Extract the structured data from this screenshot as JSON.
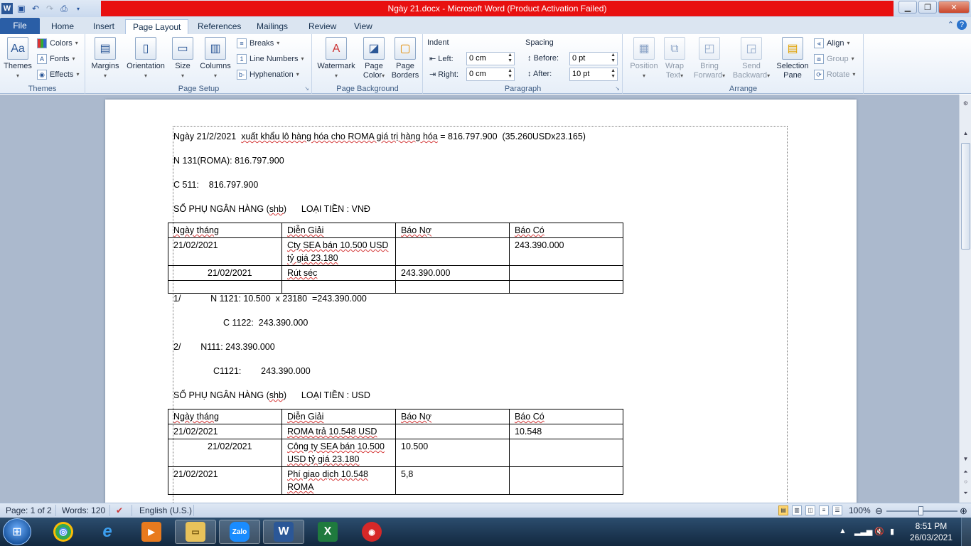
{
  "window": {
    "title": "Ngày 21.docx  -  Microsoft Word (Product Activation Failed)"
  },
  "ribbon_tabs": [
    "File",
    "Home",
    "Insert",
    "Page Layout",
    "References",
    "Mailings",
    "Review",
    "View"
  ],
  "active_tab": "Page Layout",
  "ribbon": {
    "themes": {
      "themes_btn": "Themes",
      "colors_btn": "Colors",
      "fonts_btn": "Fonts",
      "effects_btn": "Effects",
      "label": "Themes"
    },
    "page_setup": {
      "margins": "Margins",
      "orientation": "Orientation",
      "size": "Size",
      "columns": "Columns",
      "breaks": "Breaks",
      "line_numbers": "Line Numbers",
      "hyphenation": "Hyphenation",
      "label": "Page Setup"
    },
    "page_background": {
      "watermark": "Watermark",
      "page_color_1": "Page",
      "page_color_2": "Color",
      "page_borders_1": "Page",
      "page_borders_2": "Borders",
      "label": "Page Background"
    },
    "paragraph": {
      "indent_title": "Indent",
      "left_label": "Left:",
      "left_value": "0 cm",
      "right_label": "Right:",
      "right_value": "0 cm",
      "spacing_title": "Spacing",
      "before_label": "Before:",
      "before_value": "0 pt",
      "after_label": "After:",
      "after_value": "10 pt",
      "label": "Paragraph"
    },
    "arrange": {
      "position": "Position",
      "wrap_1": "Wrap",
      "wrap_2": "Text",
      "bring_1": "Bring",
      "bring_2": "Forward",
      "send_1": "Send",
      "send_2": "Backward",
      "selection_1": "Selection",
      "selection_2": "Pane",
      "align": "Align",
      "group": "Group",
      "rotate": "Rotate",
      "label": "Arrange"
    }
  },
  "document": {
    "l1_a": "Ngày 21/2/2021  ",
    "l1_b": "xuất khẩu lô hàng hóa cho ROMA giá trị hàng hóa",
    "l1_c": " = 816.797.900  (35.260USDx23.165)",
    "l2": "N 131(ROMA): 816.797.900",
    "l3": "C 511:    816.797.900",
    "l4_a": "SỔ PHỤ NGÂN HÀNG (",
    "l4_b": "shb",
    "l4_c": ")      LOẠI TIỀN : VNĐ",
    "table1": {
      "headers": [
        "Ngày tháng",
        "Diễn Giải",
        "Báo Nợ",
        "Báo Có"
      ],
      "rows": [
        [
          "21/02/2021",
          "Cty SEA bán 10.500  USD tỷ giá 23.180",
          "",
          "243.390.000"
        ],
        [
          "21/02/2021",
          "Rút séc",
          "243.390.000",
          ""
        ],
        [
          "",
          "",
          "",
          ""
        ]
      ]
    },
    "l5": "1/            N 1121: 10.500  x 23180  =243.390.000",
    "l6": "C 1122:  243.390.000",
    "l7": "2/        N111: 243.390.000",
    "l8": "C1121:        243.390.000",
    "l9_a": "SỔ PHỤ NGÂN HÀNG (",
    "l9_b": "shb",
    "l9_c": ")      LOẠI TIỀN : USD",
    "table2": {
      "headers": [
        "Ngày tháng",
        "Diễn Giải",
        "Báo Nợ",
        "Báo Có"
      ],
      "rows": [
        [
          "21/02/2021",
          "ROMA  trả 10.548  USD",
          "",
          "10.548"
        ],
        [
          "21/02/2021",
          "Công ty SEA bán 10.500 USD tỷ giá 23.180",
          "10.500",
          ""
        ],
        [
          "21/02/2021",
          "Phí giao dịch 10.548 ROMA",
          "5,8",
          ""
        ]
      ]
    }
  },
  "status": {
    "page": "Page: 1 of 2",
    "words": "Words: 120",
    "language": "English (U.S.)",
    "zoom": "100%"
  },
  "taskbar": {
    "apps": [
      "chrome",
      "internet-explorer",
      "media-player",
      "file-explorer",
      "zalo",
      "word",
      "excel",
      "other-app"
    ],
    "zalo_label": "Zalo",
    "time": "8:51 PM",
    "date": "26/03/2021"
  }
}
